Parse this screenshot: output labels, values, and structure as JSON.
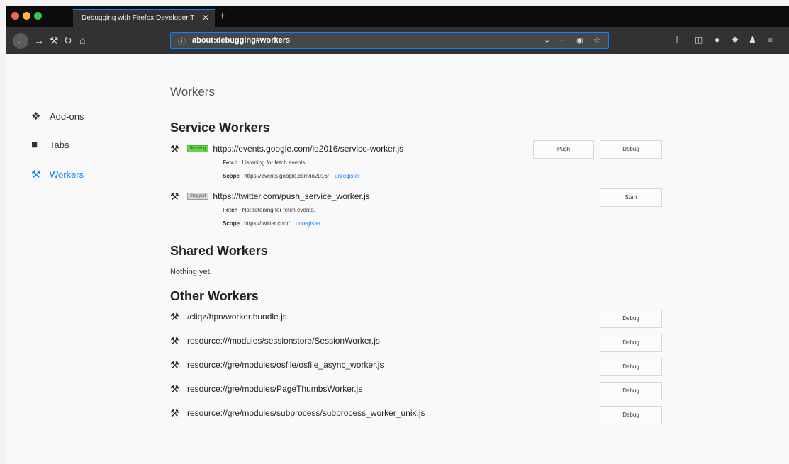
{
  "colors": {
    "accent": "#0a84ff",
    "running": "#67d64a",
    "stopped": "#d7d7db",
    "tabbar": "#0c0c0d",
    "toolbar": "#323234"
  },
  "browser": {
    "tab_title": "Debugging with Firefox Developer T",
    "tab_close": "✕",
    "new_tab": "+",
    "url": "about:debugging#workers"
  },
  "sidebar": {
    "items": [
      {
        "label": "Add-ons",
        "icon": "puzzle-icon"
      },
      {
        "label": "Tabs",
        "icon": "laptop-icon"
      },
      {
        "label": "Workers",
        "icon": "tools-icon"
      }
    ]
  },
  "main": {
    "title": "Workers",
    "service_workers": {
      "heading": "Service Workers",
      "items": [
        {
          "status": "Running",
          "url": "https://events.google.com/io2016/service-worker.js",
          "fetch_label": "Fetch",
          "fetch_value": "Listening for fetch events.",
          "scope_label": "Scope",
          "scope_value": "https://events.google.com/io2016/",
          "unregister": "unregister",
          "push_label": "Push",
          "debug_label": "Debug"
        },
        {
          "status": "Stopped",
          "url": "https://twitter.com/push_service_worker.js",
          "fetch_label": "Fetch",
          "fetch_value": "Not listening for fetch events.",
          "scope_label": "Scope",
          "scope_value": "https://twitter.com/",
          "unregister": "unregister",
          "start_label": "Start"
        }
      ]
    },
    "shared_workers": {
      "heading": "Shared Workers",
      "empty": "Nothing yet."
    },
    "other_workers": {
      "heading": "Other Workers",
      "debug_label": "Debug",
      "items": [
        "/cliqz/hpn/worker.bundle.js",
        "resource:///modules/sessionstore/SessionWorker.js",
        "resource://gre/modules/osfile/osfile_async_worker.js",
        "resource://gre/modules/PageThumbsWorker.js",
        "resource://gre/modules/subprocess/subprocess_worker_unix.js"
      ]
    }
  }
}
